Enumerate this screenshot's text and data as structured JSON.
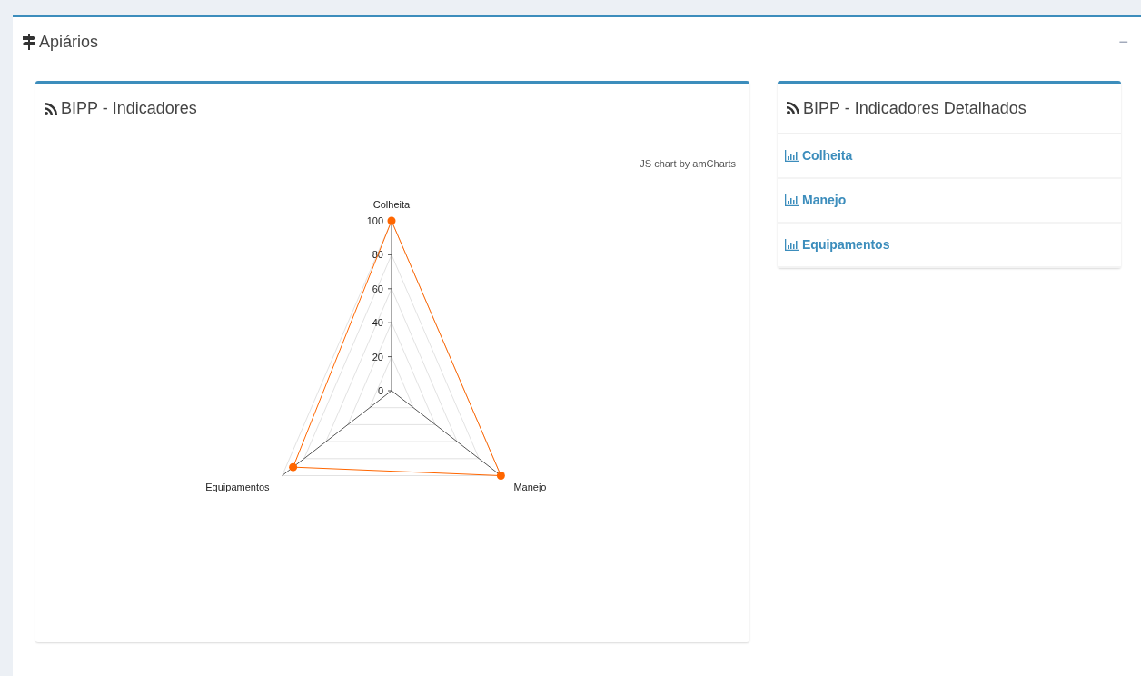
{
  "box": {
    "title": "Apiários",
    "collapse": "−"
  },
  "indicators_panel": {
    "title": "BIPP - Indicadores",
    "credit": "JS chart by amCharts",
    "radar": {
      "axis_labels": [
        "Colheita",
        "Manejo",
        "Equipamentos"
      ],
      "tick_labels": [
        "100",
        "80",
        "60",
        "40",
        "20",
        "0"
      ]
    }
  },
  "detail_panel": {
    "title": "BIPP - Indicadores Detalhados",
    "links": [
      {
        "label": "Colheita"
      },
      {
        "label": "Manejo"
      },
      {
        "label": "Equipamentos"
      }
    ]
  }
}
